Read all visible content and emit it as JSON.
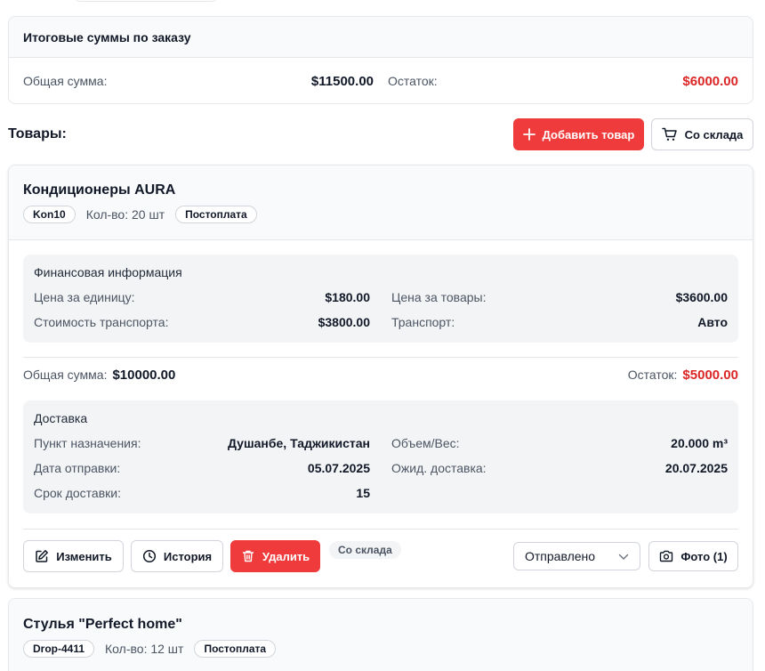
{
  "totals": {
    "title": "Итоговые суммы по заказу",
    "total_label": "Общая сумма:",
    "total_value": "$11500.00",
    "balance_label": "Остаток:",
    "balance_value": "$6000.00"
  },
  "products_section": {
    "title": "Товары:",
    "add_button": "Добавить товар",
    "warehouse_button": "Со склада"
  },
  "products": [
    {
      "name": "Кондиционеры AURA",
      "code": "Kon10",
      "quantity": "Кол-во: 20 шт",
      "payment": "Постоплата",
      "finance": {
        "title": "Финансовая информация",
        "unit_price_label": "Цена за единицу:",
        "unit_price": "$180.00",
        "goods_price_label": "Цена за товары:",
        "goods_price": "$3600.00",
        "transport_cost_label": "Стоимость транспорта:",
        "transport_cost": "$3800.00",
        "transport_label": "Транспорт:",
        "transport": "Авто"
      },
      "total_label": "Общая сумма:",
      "total_value": "$10000.00",
      "balance_label": "Остаток:",
      "balance_value": "$5000.00",
      "delivery": {
        "title": "Доставка",
        "destination_label": "Пункт назначения:",
        "destination": "Душанбе, Таджикистан",
        "volume_label": "Объем/Вес:",
        "volume": "20.000 m³",
        "ship_date_label": "Дата отправки:",
        "ship_date": "05.07.2025",
        "expected_label": "Ожид. доставка:",
        "expected": "20.07.2025",
        "term_label": "Срок доставки:",
        "term": "15"
      },
      "actions": {
        "edit": "Изменить",
        "history": "История",
        "delete": "Удалить",
        "source_tag": "Со склада",
        "status": "Отправлено",
        "photo": "Фото (1)"
      }
    },
    {
      "name": "Стулья \"Perfect home\"",
      "code": "Drop-4411",
      "quantity": "Кол-во: 12 шт",
      "payment": "Постоплата"
    }
  ],
  "colors": {
    "accent_red": "#ef3b3b",
    "amount_red": "#dc2626",
    "panel_gray": "#f3f4f6",
    "border": "#e5e7eb"
  },
  "icons": [
    "plus-icon",
    "cart-icon",
    "pencil-icon",
    "clock-icon",
    "trash-icon",
    "chevron-down-icon",
    "camera-icon"
  ]
}
